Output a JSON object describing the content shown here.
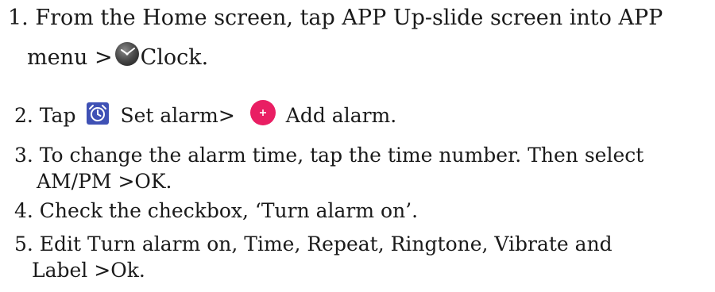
{
  "steps": [
    {
      "line1": "1. From the Home screen, tap APP  Up-slide screen into APP",
      "line2_prefix": "menu >",
      "line2_suffix": "Clock."
    },
    {
      "prefix": "2. Tap",
      "middle": "Set alarm>",
      "suffix": "Add alarm."
    },
    {
      "line1": "3. To change the alarm time, tap the time number. Then select",
      "line2": "AM/PM >OK."
    },
    {
      "line1": "4. Check the checkbox, ‘Turn alarm on’."
    },
    {
      "line1": "5. Edit Turn alarm on, Time, Repeat, Ringtone, Vibrate and",
      "line2": "Label >Ok."
    }
  ],
  "icons": {
    "clock": "clock-app-icon",
    "alarm": "set-alarm-icon",
    "add": "add-alarm-icon"
  },
  "colors": {
    "text": "#1a1a1a",
    "alarm_icon_bg": "#3f51b5",
    "add_icon_bg": "#e91e63",
    "clock_icon_bg": "#4a4a4a"
  }
}
